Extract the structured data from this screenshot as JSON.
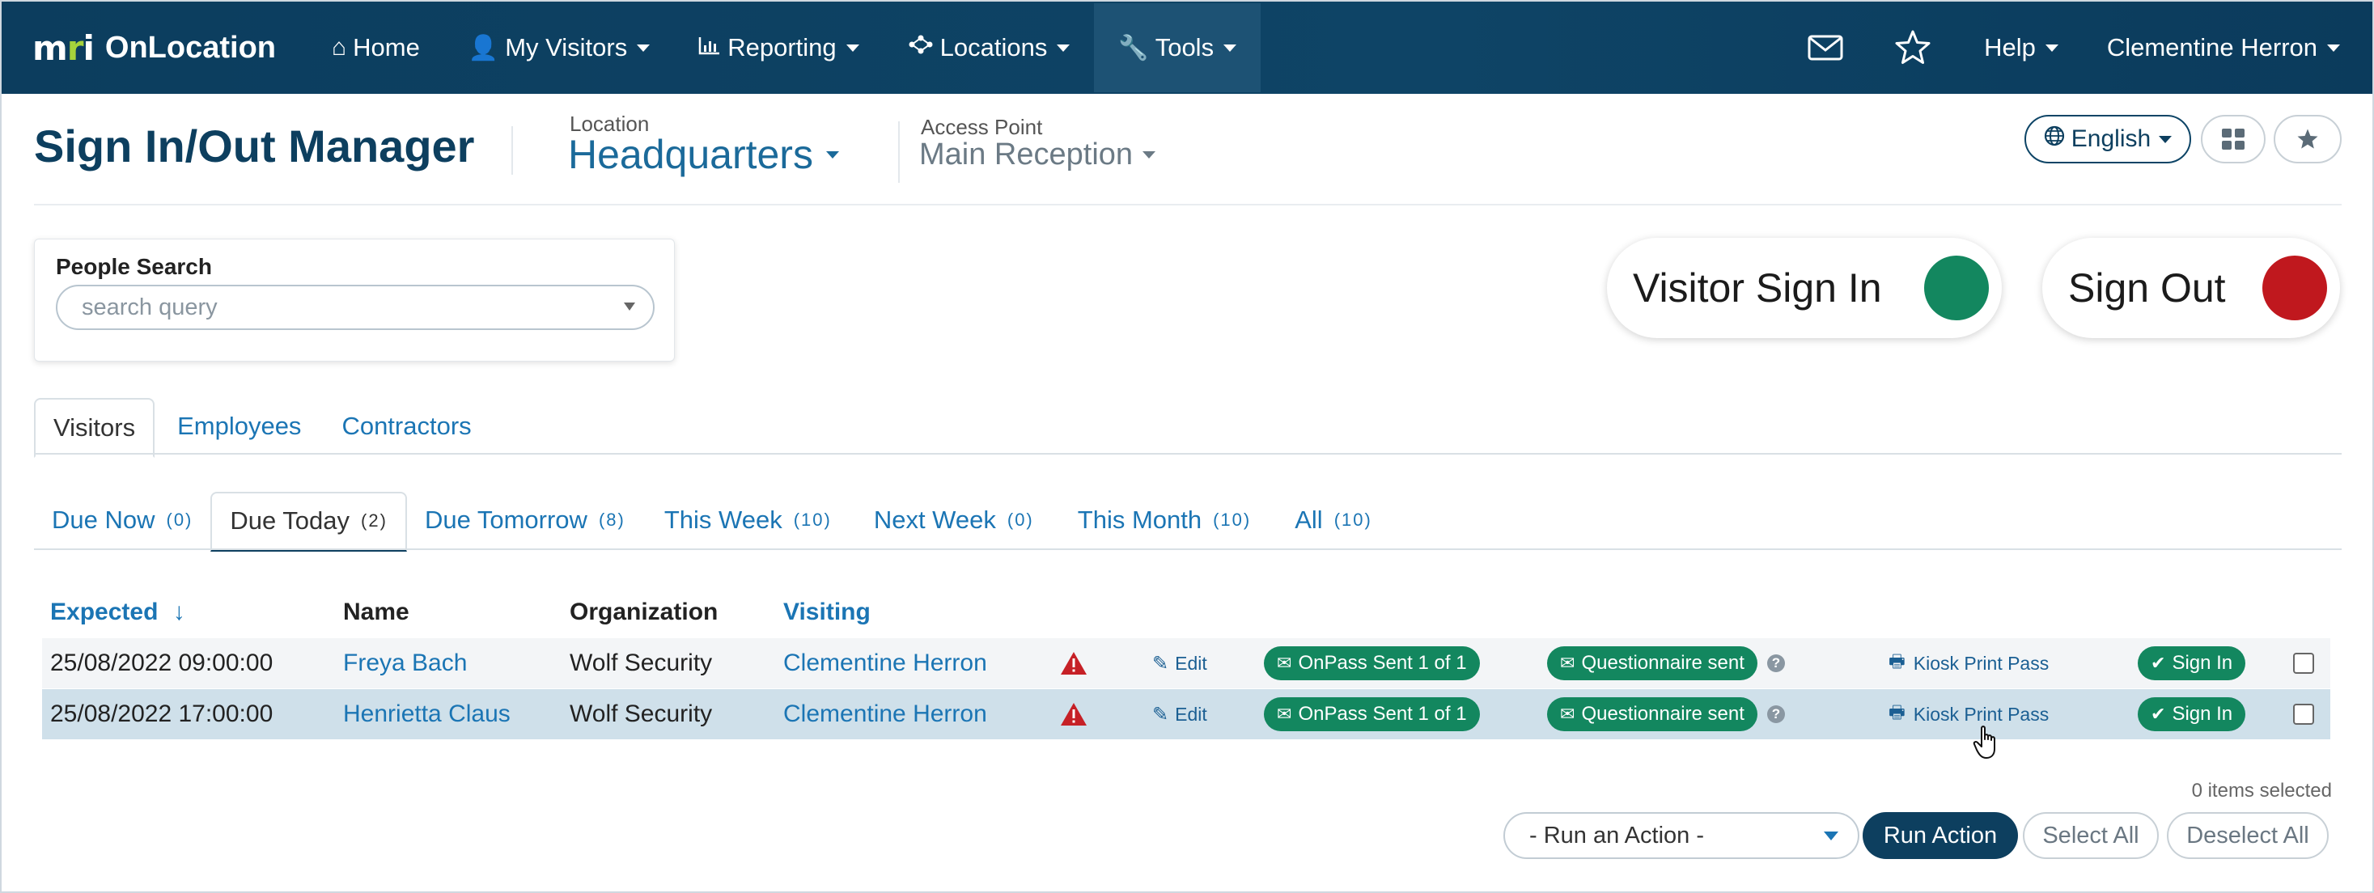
{
  "nav": {
    "brand_logo": "mri",
    "brand_name": "OnLocation",
    "items": [
      {
        "label": "Home",
        "icon": "home-icon"
      },
      {
        "label": "My Visitors",
        "icon": "user-icon"
      },
      {
        "label": "Reporting",
        "icon": "bar-chart-icon"
      },
      {
        "label": "Locations",
        "icon": "network-icon"
      },
      {
        "label": "Tools",
        "icon": "wrench-icon"
      }
    ],
    "help_label": "Help",
    "user_label": "Clementine Herron"
  },
  "header": {
    "title": "Sign In/Out Manager",
    "location_label": "Location",
    "location_value": "Headquarters",
    "access_point_label": "Access Point",
    "access_point_value": "Main Reception",
    "language_label": "English"
  },
  "search": {
    "label": "People Search",
    "placeholder": "search query"
  },
  "actions": {
    "sign_in_label": "Visitor Sign In",
    "sign_in_color": "#13875f",
    "sign_out_label": "Sign Out",
    "sign_out_color": "#c0181e"
  },
  "tabs": [
    "Visitors",
    "Employees",
    "Contractors"
  ],
  "subtabs": [
    {
      "label": "Due Now",
      "count": "(0)"
    },
    {
      "label": "Due Today",
      "count": "(2)"
    },
    {
      "label": "Due Tomorrow",
      "count": "(8)"
    },
    {
      "label": "This Week",
      "count": "(10)"
    },
    {
      "label": "Next Week",
      "count": "(0)"
    },
    {
      "label": "This Month",
      "count": "(10)"
    },
    {
      "label": "All",
      "count": "(10)"
    }
  ],
  "table": {
    "columns": {
      "expected": "Expected",
      "sort_arrow": "↓",
      "name": "Name",
      "organization": "Organization",
      "visiting": "Visiting"
    },
    "rows": [
      {
        "expected": "25/08/2022 09:00:00",
        "name": "Freya Bach",
        "organization": "Wolf Security",
        "visiting": "Clementine Herron",
        "edit": "Edit",
        "onpass": "OnPass Sent 1 of 1",
        "questionnaire": "Questionnaire sent",
        "help": "?",
        "kiosk": "Kiosk Print Pass",
        "sign_in": "Sign In"
      },
      {
        "expected": "25/08/2022 17:00:00",
        "name": "Henrietta Claus",
        "organization": "Wolf Security",
        "visiting": "Clementine Herron",
        "edit": "Edit",
        "onpass": "OnPass Sent 1 of 1",
        "questionnaire": "Questionnaire sent",
        "help": "?",
        "kiosk": "Kiosk Print Pass",
        "sign_in": "Sign In"
      }
    ]
  },
  "footer": {
    "items_selected": "0 items selected",
    "run_action_placeholder": "- Run an Action -",
    "run_action_button": "Run Action",
    "select_all": "Select All",
    "deselect_all": "Deselect All"
  }
}
